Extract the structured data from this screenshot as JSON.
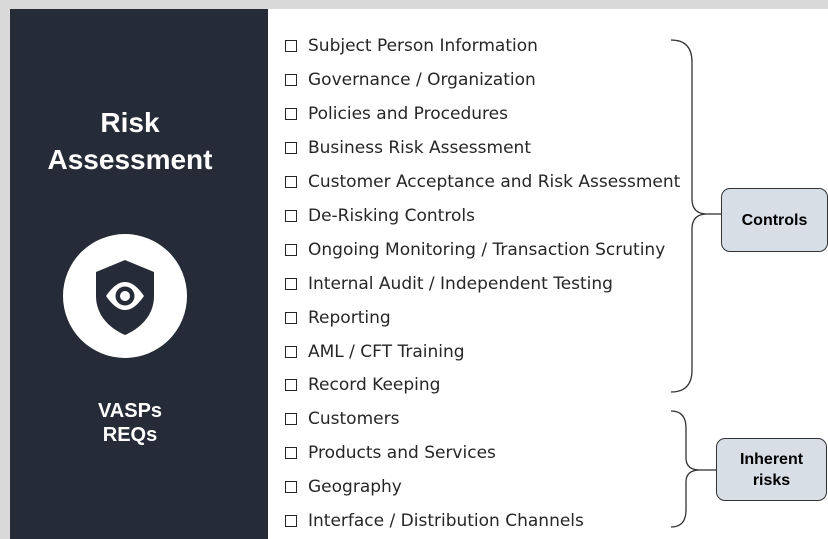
{
  "panel": {
    "title_line1": "Risk",
    "title_line2": "Assessment",
    "subtitle_line1": "VASPs",
    "subtitle_line2": "REQs"
  },
  "controls": {
    "items": [
      "Subject Person Information",
      "Governance / Organization",
      "Policies and Procedures",
      "Business Risk Assessment",
      "Customer Acceptance and Risk Assessment",
      "De-Risking Controls",
      "Ongoing Monitoring / Transaction Scrutiny",
      "Internal Audit / Independent Testing",
      "Reporting",
      "AML / CFT Training",
      "Record Keeping"
    ],
    "label": "Controls"
  },
  "inherent": {
    "items": [
      "Customers",
      "Products and Services",
      "Geography",
      "Interface / Distribution Channels"
    ],
    "label_line1": "Inherent",
    "label_line2": "risks"
  },
  "colors": {
    "panel": "#252c37",
    "box_fill": "#d7dee6"
  },
  "icons": {
    "emblem": "shield-eye-icon",
    "checkbox": "checkbox-icon"
  }
}
